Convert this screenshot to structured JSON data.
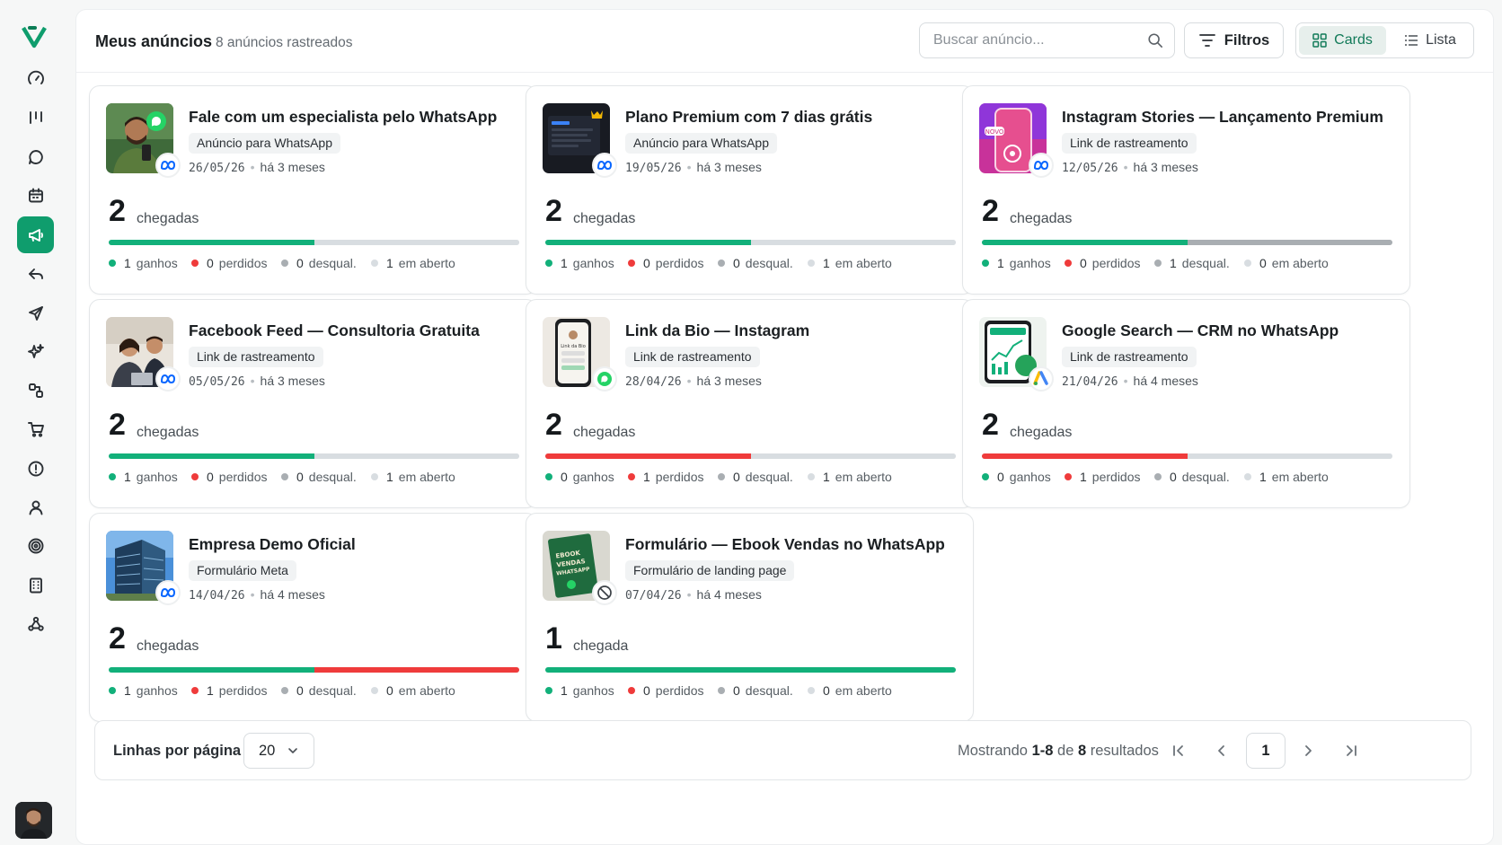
{
  "header": {
    "title": "Meus anúncios",
    "count_text": "8 anúncios rastreados",
    "search_placeholder": "Buscar anúncio...",
    "filters_label": "Filtros",
    "view_cards_label": "Cards",
    "view_list_label": "Lista",
    "active_view": "Cards"
  },
  "sidebar": {
    "items": [
      {
        "icon": "dashboard-gauge-icon",
        "active": false
      },
      {
        "icon": "kanban-icon",
        "active": false
      },
      {
        "icon": "chat-icon",
        "active": false
      },
      {
        "icon": "calendar-icon",
        "active": false
      },
      {
        "icon": "megaphone-icon",
        "active": true
      },
      {
        "icon": "reply-icon",
        "active": false
      },
      {
        "icon": "send-icon",
        "active": false
      },
      {
        "icon": "sparkles-icon",
        "active": false
      },
      {
        "icon": "workflow-icon",
        "active": false
      },
      {
        "icon": "cart-icon",
        "active": false
      },
      {
        "icon": "alert-circle-icon",
        "active": false
      },
      {
        "icon": "user-icon",
        "active": false
      },
      {
        "icon": "target-icon",
        "active": false
      },
      {
        "icon": "building-icon",
        "active": false
      },
      {
        "icon": "webhook-icon",
        "active": false
      }
    ]
  },
  "legend_labels": {
    "ganhos": "ganhos",
    "perdidos": "perdidos",
    "desqual": "desqual.",
    "aberto": "em aberto"
  },
  "colors": {
    "ganhos": "#12b07a",
    "perdidos": "#ef3b3b",
    "desqual": "#a9aeb2",
    "aberto": "#d8dde1",
    "accent": "#0f9d6d"
  },
  "cards": [
    {
      "title": "Fale com um especialista pelo WhatsApp",
      "tag": "Anúncio para WhatsApp",
      "date": "26/05/26",
      "ago": "há 3 meses",
      "count": "2",
      "count_label": "chegadas",
      "ganhos": 1,
      "perdidos": 0,
      "desqual": 0,
      "aberto": 1,
      "badge": "meta"
    },
    {
      "title": "Plano Premium com 7 dias grátis",
      "tag": "Anúncio para WhatsApp",
      "date": "19/05/26",
      "ago": "há 3 meses",
      "count": "2",
      "count_label": "chegadas",
      "ganhos": 1,
      "perdidos": 0,
      "desqual": 0,
      "aberto": 1,
      "badge": "meta"
    },
    {
      "title": "Instagram Stories — Lançamento Premium",
      "tag": "Link de rastreamento",
      "date": "12/05/26",
      "ago": "há 3 meses",
      "count": "2",
      "count_label": "chegadas",
      "ganhos": 1,
      "perdidos": 0,
      "desqual": 1,
      "aberto": 0,
      "badge": "meta"
    },
    {
      "title": "Facebook Feed — Consultoria Gratuita",
      "tag": "Link de rastreamento",
      "date": "05/05/26",
      "ago": "há 3 meses",
      "count": "2",
      "count_label": "chegadas",
      "ganhos": 1,
      "perdidos": 0,
      "desqual": 0,
      "aberto": 1,
      "badge": "meta"
    },
    {
      "title": "Link da Bio — Instagram",
      "tag": "Link de rastreamento",
      "date": "28/04/26",
      "ago": "há 3 meses",
      "count": "2",
      "count_label": "chegadas",
      "ganhos": 0,
      "perdidos": 1,
      "desqual": 0,
      "aberto": 1,
      "badge": "whatsapp"
    },
    {
      "title": "Google Search — CRM no WhatsApp",
      "tag": "Link de rastreamento",
      "date": "21/04/26",
      "ago": "há 4 meses",
      "count": "2",
      "count_label": "chegadas",
      "ganhos": 0,
      "perdidos": 1,
      "desqual": 0,
      "aberto": 1,
      "badge": "google-ads"
    },
    {
      "title": "Empresa Demo Oficial",
      "tag": "Formulário Meta",
      "date": "14/04/26",
      "ago": "há 4 meses",
      "count": "2",
      "count_label": "chegadas",
      "ganhos": 1,
      "perdidos": 1,
      "desqual": 0,
      "aberto": 0,
      "badge": "meta"
    },
    {
      "title": "Formulário — Ebook Vendas no WhatsApp",
      "tag": "Formulário de landing page",
      "date": "07/04/26",
      "ago": "há 4 meses",
      "count": "1",
      "count_label": "chegada",
      "ganhos": 1,
      "perdidos": 0,
      "desqual": 0,
      "aberto": 0,
      "badge": "blocked"
    }
  ],
  "footer": {
    "rows_label": "Linhas por página",
    "rows_value": "20",
    "showing_prefix": "Mostrando",
    "showing_range": "1-8",
    "showing_of": "de",
    "showing_total": "8",
    "showing_suffix": "resultados",
    "current_page": "1"
  }
}
